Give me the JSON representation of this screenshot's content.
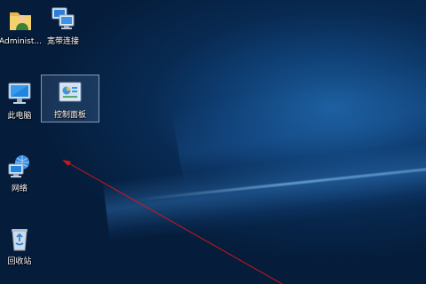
{
  "desktop": {
    "icons": [
      {
        "label": "Administ...",
        "icon": "user-folder-icon"
      },
      {
        "label": "宽带连接",
        "icon": "broadband-connection-icon"
      },
      {
        "label": "此电脑",
        "icon": "this-pc-icon"
      },
      {
        "label": "控制面板",
        "icon": "control-panel-icon",
        "selected": true
      },
      {
        "label": "网络",
        "icon": "network-icon"
      },
      {
        "label": "回收站",
        "icon": "recycle-bin-icon"
      }
    ],
    "annotation": {
      "color": "#d0161b",
      "icon": "red-arrow-annotation"
    }
  }
}
